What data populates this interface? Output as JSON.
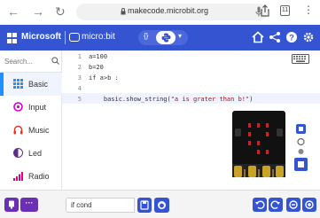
{
  "browser": {
    "url": "makecode.microbit.org",
    "tab_count": "11"
  },
  "header": {
    "microsoft_label": "Microsoft",
    "app_label": "micro:bit",
    "toggle_js": "{}",
    "toggle_chevron": "▾"
  },
  "sidebar": {
    "search_placeholder": "Search...",
    "categories": [
      {
        "label": "Basic",
        "color": "#1e90ff",
        "icon": "grid-icon"
      },
      {
        "label": "Input",
        "color": "#d400d4",
        "icon": "target-icon"
      },
      {
        "label": "Music",
        "color": "#e63022",
        "icon": "headphones-icon"
      },
      {
        "label": "Led",
        "color": "#5c2d91",
        "icon": "toggle-icon"
      },
      {
        "label": "Radio",
        "color": "#e3008c",
        "icon": "signal-icon"
      }
    ]
  },
  "editor": {
    "lines": [
      {
        "num": "1",
        "code": "a=100"
      },
      {
        "num": "2",
        "code": "b=20"
      },
      {
        "num": "3",
        "code": "if a>b :"
      },
      {
        "num": "4",
        "code": ""
      },
      {
        "num": "5",
        "code": "    basic.show_string(",
        "string": "\"a is grater than b!\"",
        "tail": ")"
      }
    ]
  },
  "footer": {
    "project_name": "if cond",
    "more_label": "···"
  },
  "colors": {
    "header": "#3454d1",
    "accent_purple": "#6b2fb3"
  }
}
